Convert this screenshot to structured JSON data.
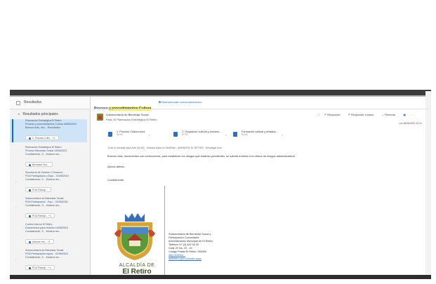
{
  "results_header": "Resultados",
  "top_results_label": "Resultados principales",
  "message_list": [
    {
      "lines": [
        "Planeación Estratégica El Retiro",
        "Proceso y procedimientos Cultura 08/06/2024",
        "Buenos días, doc...   Resultados"
      ],
      "attachment": "1. Proceso Cultu...",
      "attachment_extra": "+1",
      "selected": true
    },
    {
      "lines": [
        "Planeación Estratégica El Retiro",
        "Proceso Bienestar Social  13/06/2024",
        "Cordialmente, S...   Mostrar res..."
      ],
      "attachment": "Bienestar Soc...",
      "attachment_extra": "",
      "selected": false
    },
    {
      "lines": [
        "Secretaría de Gestión Y Desarrol...",
        "POA Participación y Equi...  01/06/2024",
        "Cordialmente, S...   Mostrar res..."
      ],
      "attachment": "POA Particip...",
      "attachment_extra": "",
      "selected": false
    },
    {
      "lines": [
        "Subsecretaría de Bienestar Social",
        "POA Participación - Equ...  01/06/2024",
        "Cordialmente, S...   Mostrar res..."
      ],
      "attachment": "POA Particip...",
      "attachment_extra": "+1",
      "selected": false
    },
    {
      "lines": [
        "Control Interno El Retiro",
        "Documentos para revisión  10/06/2024",
        "Cordialmente, S...   Mostrar res..."
      ],
      "attachment": "Informe revi...",
      "attachment_extra": "+1",
      "selected": false
    },
    {
      "lines": [
        "Subsecretaría de Bienestar Social",
        "POA Participación equid...  01/06/2024",
        "Cordialmente, S...   Mostrar res..."
      ],
      "attachment": "POA Particip...",
      "attachment_extra": "+1",
      "selected": false
    }
  ],
  "email": {
    "subject_prefix": "Proceso",
    "subject_hl": "y procedimientos Cultura",
    "resend_label": "Reenviar este correo electrónico",
    "sender": "Subsecretaría de Bienestar Social",
    "to": "Para: El Planeación Estratégica El Retiro",
    "actions": [
      "Responder",
      "Responder a todos",
      "Reenviar"
    ],
    "date": "Lun 08/06/2024 10:21",
    "attachments": [
      {
        "name": "1. Proceso Cultura.docx",
        "size": "54 KB"
      },
      {
        "name": "2. Ocupación cultural y proceso...",
        "size": "67 KB"
      },
      {
        "name": "Formación cultural y artística...",
        "size": "51 KB"
      }
    ],
    "forwarded_note": "Cree el mensaje para este (01:05)  -  Guardar todos en OneDrive - MUNICIPIO EL RETIRO  -  Descargar todo",
    "body_greeting": "Buenos días, documentos con correcciones, para establecer los riesgos que estarían pendientes, se solicita enviarlo a la oficina de riesgos administrativos.",
    "body_attention": "Quedo atenta.",
    "body_closing": "Cordialmente,",
    "logo_line1": "ALCALDÍA DE",
    "logo_line2": "El Retiro",
    "signature": [
      "Subsecretaría de Bienestar Social y",
      "Participación Comunitaria",
      "Administración Municipal de El Retiro",
      "Teléfono 57 (4) 452 54 00",
      "Calle 20 No. 20 - 40",
      "Código Postal El Retiro: 055430",
      "http://elretiro...",
      "aeltiretiro.gov.co/index.aspx"
    ]
  },
  "colors": {
    "highlight": "#fff35c",
    "accent": "#0f6cbd",
    "selected_bg": "#cfe4f7"
  }
}
